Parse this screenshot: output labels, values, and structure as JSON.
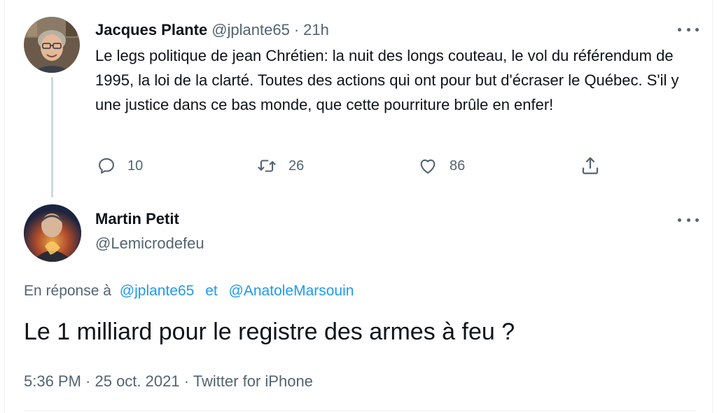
{
  "parent_tweet": {
    "author_name": "Jacques Plante",
    "handle": "@jplante65",
    "separator": "·",
    "time": "21h",
    "text": "Le legs politique de jean Chrétien: la nuit des longs couteau, le vol du référendum de 1995, la loi de la clarté. Toutes des actions qui ont pour but d'écraser le Québec. S'il y une justice dans ce bas monde, que cette pourriture brûle en enfer!",
    "replies": "10",
    "retweets": "26",
    "likes": "86",
    "icons": [
      "reply-icon",
      "retweet-icon",
      "like-icon",
      "share-icon",
      "more-icon"
    ]
  },
  "main_tweet": {
    "author_name": "Martin Petit",
    "handle": "@Lemicrodefeu",
    "reply_prefix": "En réponse à",
    "reply_to_1": "@jplante65",
    "reply_and": "et",
    "reply_to_2": "@AnatoleMarsouin",
    "text": "Le 1 milliard pour le registre des armes à feu ?",
    "timestamp": "5:36 PM · 25 oct. 2021 · Twitter for iPhone"
  },
  "colors": {
    "text": "#0f1419",
    "muted": "#536471",
    "link": "#1d9bf0",
    "thread_line": "#cfd9de",
    "border": "#eff3f4"
  }
}
